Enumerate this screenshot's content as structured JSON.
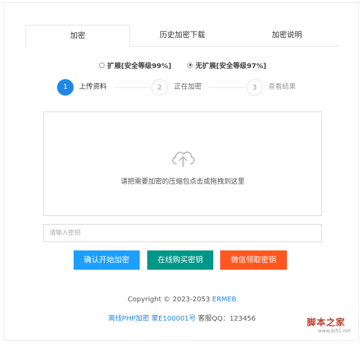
{
  "tabs": [
    {
      "label": "加密",
      "active": true
    },
    {
      "label": "历史加密下载",
      "active": false
    },
    {
      "label": "加密说明",
      "active": false
    }
  ],
  "mode_options": [
    {
      "label": "扩展[安全等级99%]",
      "checked": false
    },
    {
      "label": "无扩展[安全等级97%]",
      "checked": true
    }
  ],
  "steps": [
    {
      "number": "1",
      "label": "上传资料",
      "active": true
    },
    {
      "number": "2",
      "label": "正在加密",
      "active": false
    },
    {
      "number": "3",
      "label": "查看结果",
      "active": false
    }
  ],
  "upload": {
    "icon": "cloud-upload-icon",
    "hint": "请把需要加密的压缩包点击或拖拽到这里"
  },
  "key_input": {
    "value": "",
    "placeholder": "请输入密钥"
  },
  "buttons": {
    "confirm": "确认开始加密",
    "buy_online": "在线购买密钥",
    "wechat": "微信领取密钥"
  },
  "colors": {
    "accent": "#1e88e5",
    "confirm_bg": "#1e9fff",
    "buy_bg": "#009688",
    "wechat_bg": "#ff5722"
  },
  "footer": {
    "copyright_text": "Copyright © 2023-2053 ",
    "copyright_link": "ERMEB",
    "icp_link": "离线PHP加密 蒙E100001号",
    "support_text": " 客服QQ：123456"
  },
  "watermark": {
    "main": "脚本之家",
    "sub": "www.jb51.net"
  }
}
